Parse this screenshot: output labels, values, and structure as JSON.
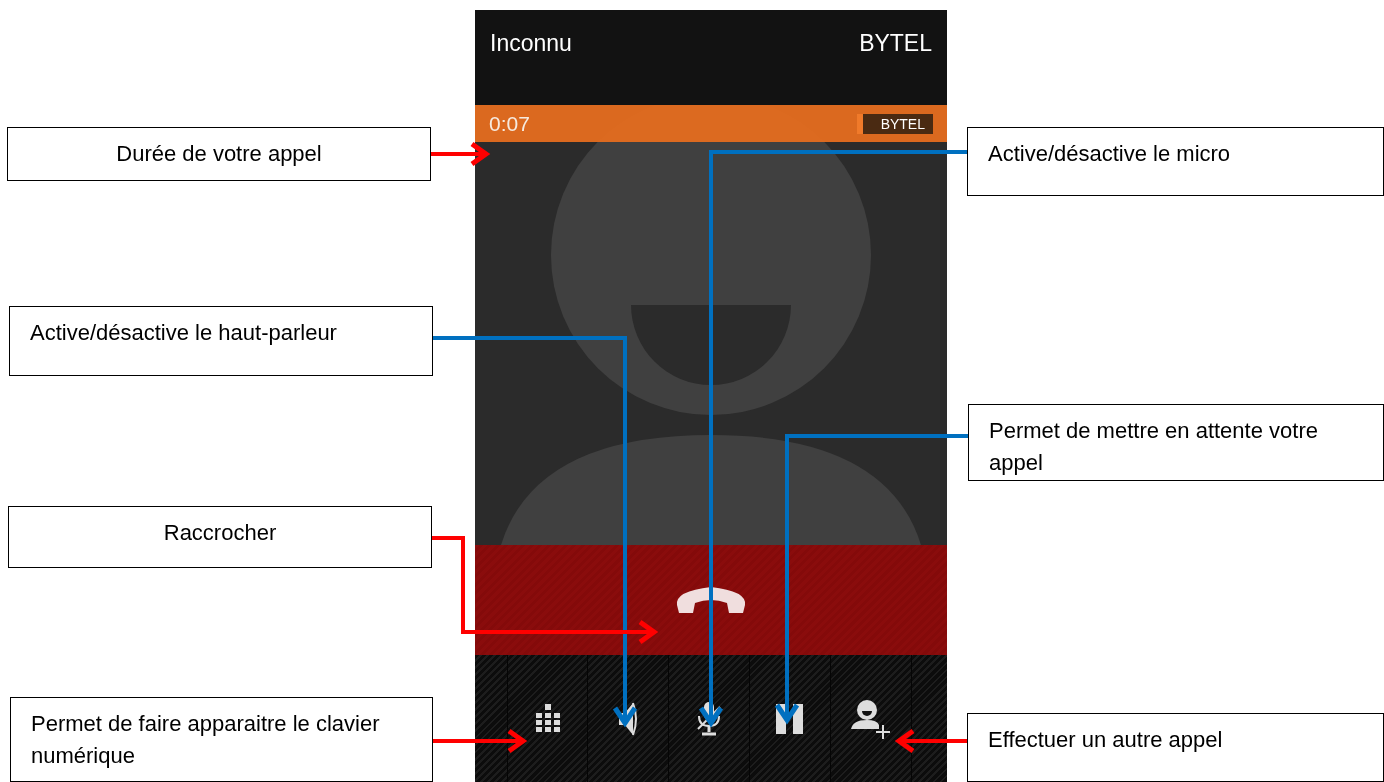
{
  "phone": {
    "caller": "Inconnu",
    "carrier": "BYTEL",
    "duration": "0:07",
    "carrier_badge": "BYTEL"
  },
  "callouts": [
    {
      "text": "Durée de votre appel",
      "color": "#ff0000"
    },
    {
      "text": "Active/désactive le haut-parleur",
      "color": "#0070c0"
    },
    {
      "text": "Raccrocher",
      "color": "#ff0000"
    },
    {
      "text": "Permet de faire apparaitre le clavier numérique",
      "color": "#ff0000"
    },
    {
      "text": "Active/désactive le micro",
      "color": "#0070c0"
    },
    {
      "text": "Permet de mettre en attente votre appel",
      "color": "#0070c0"
    },
    {
      "text": "Effectuer un autre appel",
      "color": "#ff0000"
    }
  ]
}
